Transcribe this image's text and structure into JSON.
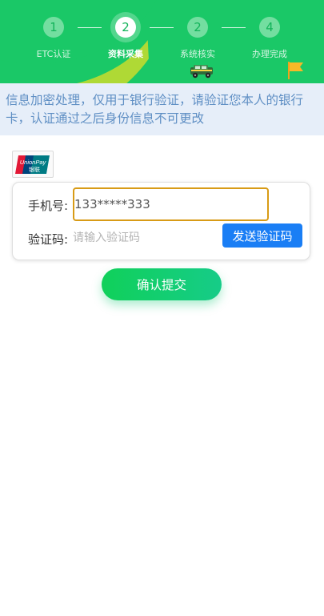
{
  "steps": [
    {
      "number": "1",
      "label": "ETC认证",
      "active": false
    },
    {
      "number": "2",
      "label": "资料采集",
      "active": true
    },
    {
      "number": "2",
      "label": "系统核实",
      "active": false
    },
    {
      "number": "4",
      "label": "办理完成",
      "active": false
    }
  ],
  "icons": {
    "car": "car-icon",
    "flag": "flag-icon",
    "bank": "unionpay-logo"
  },
  "notice": {
    "text": "信息加密处理，仅用于银行验证，请验证您本人的银行卡，认证通过之后身份信息不可更改"
  },
  "bank_logo": {
    "text_top": "UnionPay",
    "text_bottom": "银联"
  },
  "form": {
    "phone_label": "手机号:",
    "phone_value": "133*****333",
    "code_label": "验证码:",
    "code_placeholder": "请输入验证码",
    "send_code_label": "发送验证码"
  },
  "submit": {
    "label": "确认提交"
  },
  "colors": {
    "header_bg": "#1ac867",
    "accent_blue": "#1a7ef5",
    "notice_text": "#5f8fc4",
    "input_focus_border": "#d89b16"
  }
}
